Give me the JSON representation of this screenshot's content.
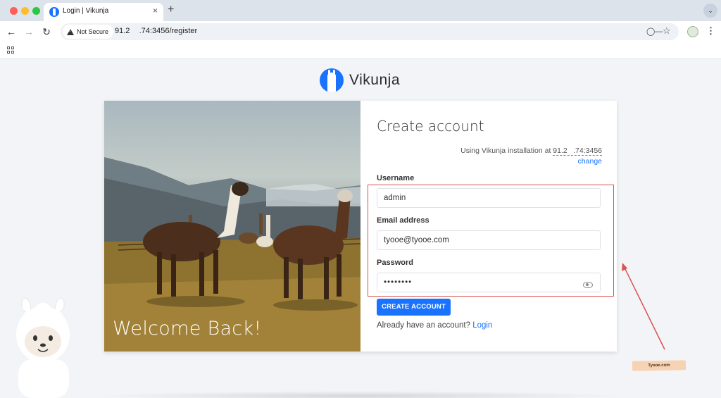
{
  "browser": {
    "tab_title": "Login | Vikunja",
    "tab_close": "×",
    "new_tab": "+",
    "security_label": "Not Secure",
    "url": "91.2      .74:3456/register",
    "icons": [
      "back-icon",
      "forward-icon",
      "reload-icon",
      "warning-icon",
      "key-icon",
      "star-icon",
      "extension-icon",
      "more-icon",
      "apps-icon"
    ]
  },
  "brand": {
    "name": "Vikunja"
  },
  "hero": {
    "heading": "Welcome Back!"
  },
  "form": {
    "title": "Create account",
    "install_prefix": "Using Vikunja installation at ",
    "install_host": "91.2    .74:3456",
    "change_label": "change",
    "username_label": "Username",
    "username_value": "admin",
    "email_label": "Email address",
    "email_value": "tyooe@tyooe.com",
    "password_label": "Password",
    "password_value": "••••••••",
    "submit_label": "CREATE ACCOUNT",
    "login_prompt": "Already have an account?",
    "login_link": "Login"
  },
  "watermark": {
    "text": "Tyooe.com"
  },
  "colors": {
    "accent": "#1973ff",
    "annotation": "#d9534f"
  }
}
